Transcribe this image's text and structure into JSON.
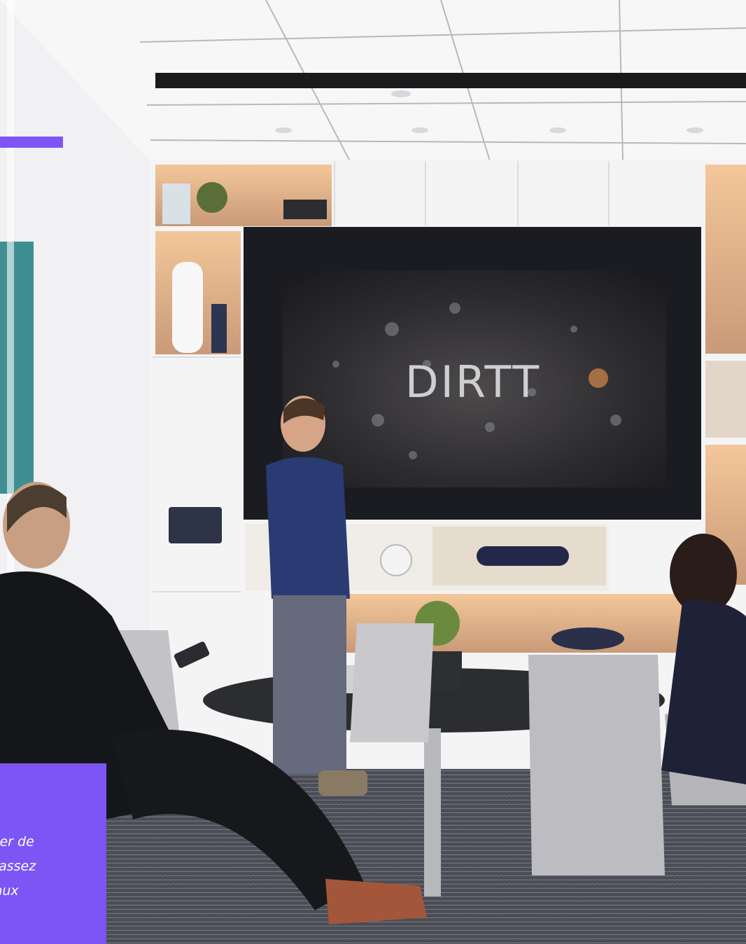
{
  "screen_text": "DIRTT",
  "caption": {
    "lines": [
      "nter de",
      "n assez",
      "eaux"
    ]
  },
  "colors": {
    "accent": "#7c55f4",
    "screen_frame": "#1b1c22",
    "wall": "#f5f4f5",
    "window_teal": "#3d8f91",
    "carpet": "#4d4f57"
  }
}
